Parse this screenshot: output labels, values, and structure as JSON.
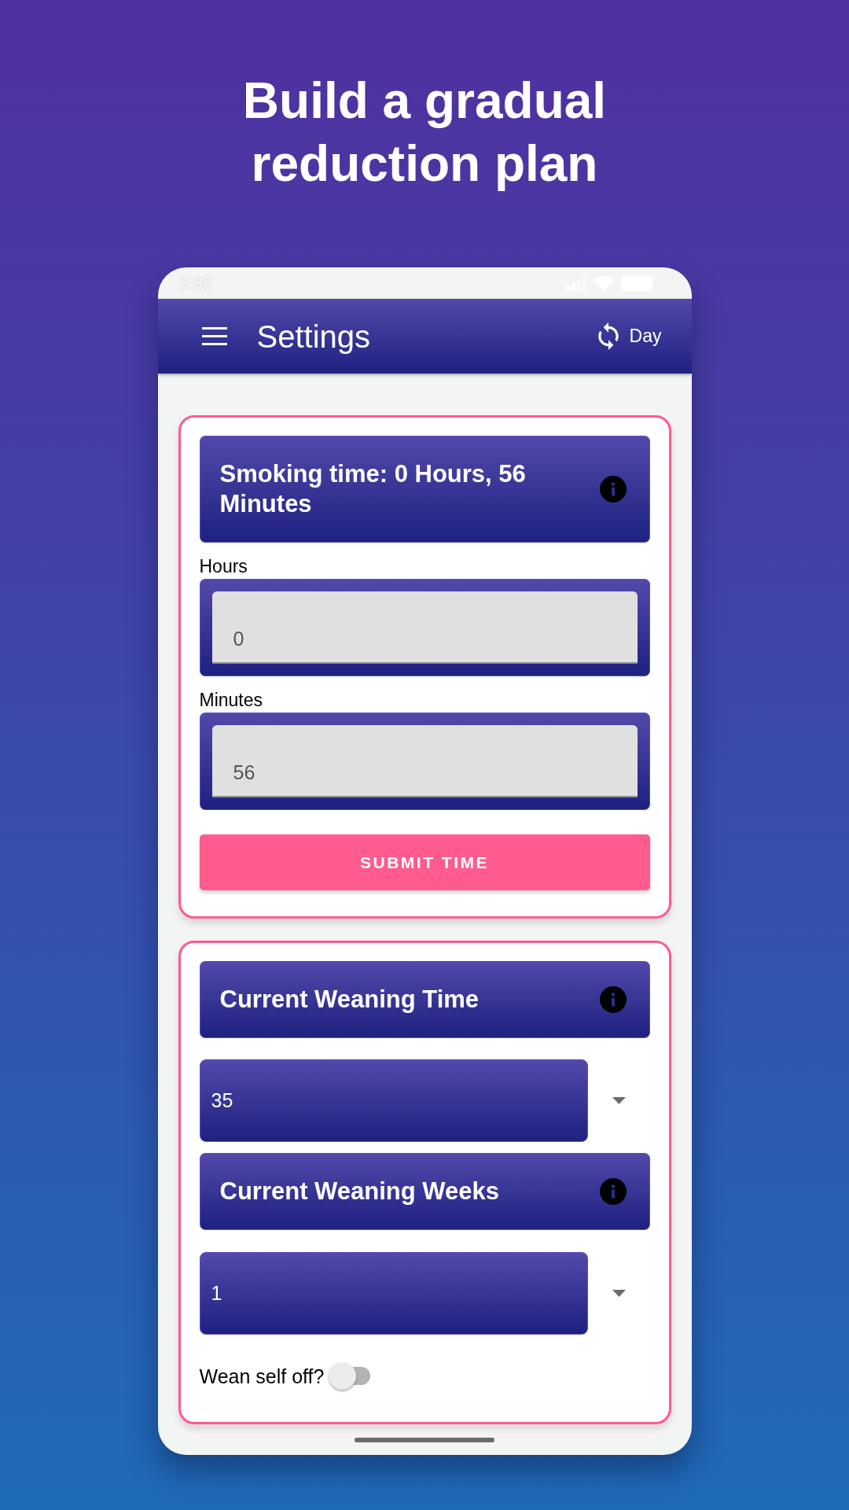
{
  "headline": "Build a gradual reduction plan",
  "status_bar": {
    "time": "2:38"
  },
  "app_bar": {
    "title": "Settings",
    "action": "Day"
  },
  "smoking_time_card": {
    "title": "Smoking time: 0 Hours, 56 Minutes",
    "fields": [
      {
        "label": "Hours",
        "value": "0"
      },
      {
        "label": "Minutes",
        "value": "56"
      }
    ],
    "button": "SUBMIT TIME"
  },
  "weaning_card": {
    "sections": [
      {
        "title": "Current Weaning Time",
        "value": "35"
      },
      {
        "title": "Current Weaning Weeks",
        "value": "1"
      }
    ],
    "toggle": {
      "label": "Wean self off?",
      "on": false
    }
  }
}
